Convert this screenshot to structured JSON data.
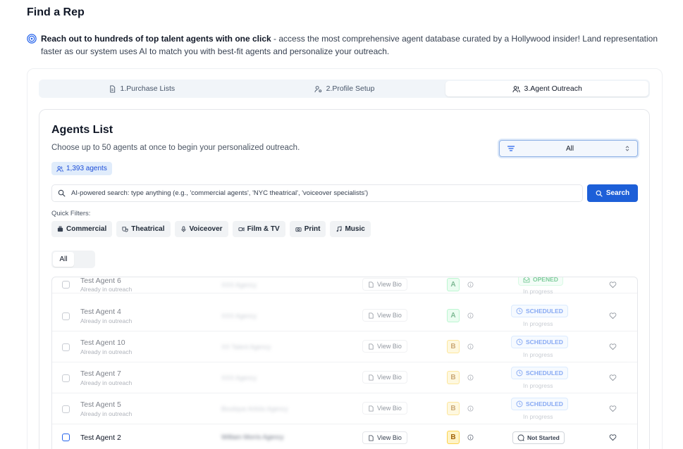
{
  "page": {
    "title": "Find a Rep",
    "intro_bold": "Reach out to hundreds of top talent agents with one click",
    "intro_rest": " - access the most comprehensive agent database curated by a Hollywood insider! Land representation faster as our system uses AI to match you with best-fit agents and personalize your outreach."
  },
  "steps": [
    {
      "label": "1.Purchase Lists",
      "icon": "document-icon",
      "active": false
    },
    {
      "label": "2.Profile Setup",
      "icon": "user-settings-icon",
      "active": false
    },
    {
      "label": "3.Agent Outreach",
      "icon": "users-icon",
      "active": true
    }
  ],
  "agents": {
    "title": "Agents List",
    "subtitle": "Choose up to 50 agents at once to begin your personalized outreach.",
    "count_label": "1,393 agents",
    "filter_value": "All"
  },
  "search": {
    "placeholder": "AI-powered search: type anything (e.g., 'commercial agents', 'NYC theatrical', 'voiceover specialists')",
    "button_label": "Search"
  },
  "quick_filters": {
    "label": "Quick Filters:",
    "items": [
      {
        "label": "Commercial",
        "icon": "briefcase-icon"
      },
      {
        "label": "Theatrical",
        "icon": "theater-icon"
      },
      {
        "label": "Voiceover",
        "icon": "mic-icon"
      },
      {
        "label": "Film & TV",
        "icon": "video-icon"
      },
      {
        "label": "Print",
        "icon": "camera-icon"
      },
      {
        "label": "Music",
        "icon": "music-icon"
      }
    ]
  },
  "tabs": {
    "all_label": "All"
  },
  "rows": [
    {
      "name": "Test Agent 6",
      "sub": "Already in outreach",
      "agency": "XXX Agency",
      "bio": "View Bio",
      "grade": "A",
      "status": "OPENED",
      "status_type": "opened",
      "progress": "In progress",
      "dim": true
    },
    {
      "name": "Test Agent 4",
      "sub": "Already in outreach",
      "agency": "XXX Agency",
      "bio": "View Bio",
      "grade": "A",
      "status": "SCHEDULED",
      "status_type": "scheduled",
      "progress": "In progress",
      "dim": true
    },
    {
      "name": "Test Agent 10",
      "sub": "Already in outreach",
      "agency": "XX Talent Agency",
      "bio": "View Bio",
      "grade": "B",
      "status": "SCHEDULED",
      "status_type": "scheduled",
      "progress": "In progress",
      "dim": true
    },
    {
      "name": "Test Agent 7",
      "sub": "Already in outreach",
      "agency": "XXX Agency",
      "bio": "View Bio",
      "grade": "B",
      "status": "SCHEDULED",
      "status_type": "scheduled",
      "progress": "In progress",
      "dim": true
    },
    {
      "name": "Test Agent 5",
      "sub": "Already in outreach",
      "agency": "Boutique Artists Agency",
      "bio": "View Bio",
      "grade": "B",
      "status": "SCHEDULED",
      "status_type": "scheduled",
      "progress": "In progress",
      "dim": true
    },
    {
      "name": "Test Agent 2",
      "sub": "",
      "agency": "William Morris Agency",
      "bio": "View Bio",
      "grade": "B",
      "status": "Not Started",
      "status_type": "notstarted",
      "progress": "",
      "dim": false
    }
  ],
  "colors": {
    "primary": "#1d5fd8",
    "badge_bg": "#e0ecfb",
    "grade_a": "#dcfce7",
    "grade_b": "#fef3c7"
  }
}
